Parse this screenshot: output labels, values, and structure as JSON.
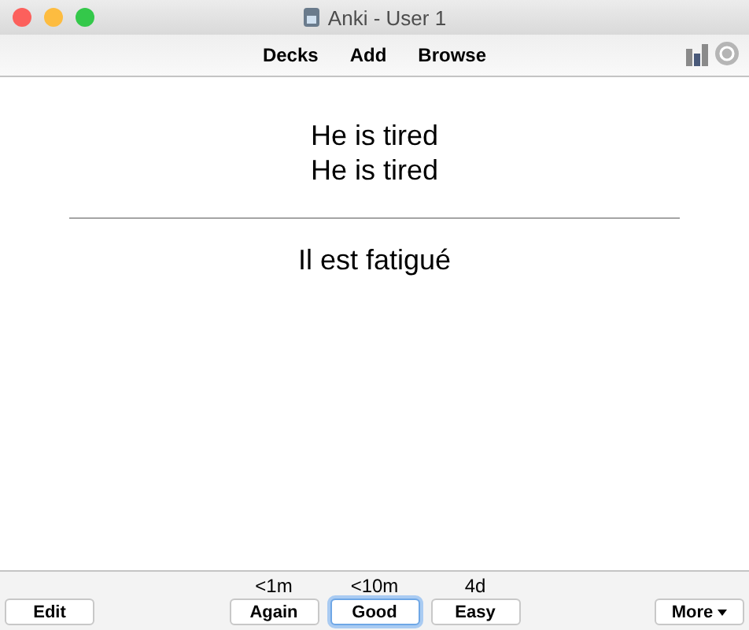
{
  "window": {
    "title": "Anki - User 1"
  },
  "toolbar": {
    "links": [
      "Decks",
      "Add",
      "Browse"
    ]
  },
  "card": {
    "question": [
      "He is tired",
      "He is tired"
    ],
    "answer": "Il est fatigué"
  },
  "bottom_bar": {
    "edit_button": "Edit",
    "answers": [
      {
        "interval": "<1m",
        "label": "Again",
        "selected": false
      },
      {
        "interval": "<10m",
        "label": "Good",
        "selected": true
      },
      {
        "interval": "4d",
        "label": "Easy",
        "selected": false
      }
    ],
    "more_button": "More"
  }
}
